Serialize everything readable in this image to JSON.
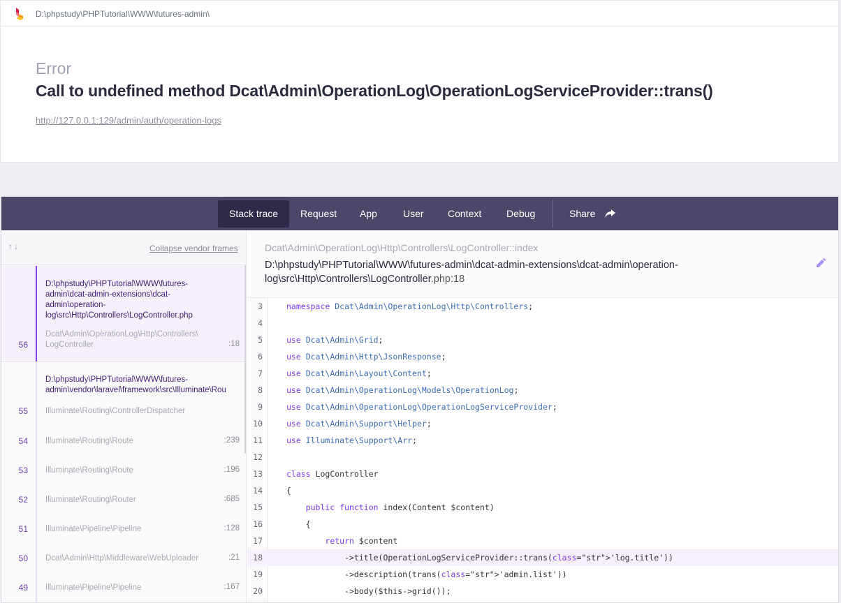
{
  "topbar": {
    "path": "D:\\phpstudy\\PHPTutorial\\WWW\\futures-admin\\"
  },
  "error": {
    "type": "Error",
    "message": "Call to undefined method Dcat\\Admin\\OperationLog\\OperationLogServiceProvider::trans()",
    "url": "http://127.0.0.1:129/admin/auth/operation-logs"
  },
  "tabs": [
    {
      "label": "Stack trace",
      "active": true
    },
    {
      "label": "Request"
    },
    {
      "label": "App"
    },
    {
      "label": "User"
    },
    {
      "label": "Context"
    },
    {
      "label": "Debug"
    },
    {
      "label": "Share"
    }
  ],
  "frames_panel": {
    "sort_arrows": "↑↓",
    "collapse_label": "Collapse vendor frames"
  },
  "frames": [
    {
      "num": "56",
      "file": "D:\\phpstudy\\PHPTutorial\\WWW\\futures-\nadmin\\dcat-admin-extensions\\dcat-\nadmin\\operation-\nlog\\src\\Http\\Controllers\\LogController.php",
      "cls": "Dcat\\Admin\\OperationLog\\Http\\Controllers\\\nLogController",
      "line": ":18",
      "selected": true
    },
    {
      "num": "55",
      "file": "D:\\phpstudy\\PHPTutorial\\WWW\\futures-\nadmin\\vendor\\laravel\\framework\\src\\Illuminate\\Rou",
      "cls": "Illuminate\\Routing\\ControllerDispatcher",
      "line": ""
    },
    {
      "num": "54",
      "cls": "Illuminate\\Routing\\Route",
      "line": ":239"
    },
    {
      "num": "53",
      "cls": "Illuminate\\Routing\\Route",
      "line": ":196"
    },
    {
      "num": "52",
      "cls": "Illuminate\\Routing\\Router",
      "line": ":685"
    },
    {
      "num": "51",
      "cls": "Illuminate\\Pipeline\\Pipeline",
      "line": ":128"
    },
    {
      "num": "50",
      "cls": "Dcat\\Admin\\Http\\Middleware\\WebUploader",
      "line": ":21"
    },
    {
      "num": "49",
      "cls": "Illuminate\\Pipeline\\Pipeline",
      "line": ":167"
    }
  ],
  "code_header": {
    "namespace": "Dcat\\Admin\\OperationLog\\Http\\Controllers\\LogController::index",
    "file": "D:\\phpstudy\\PHPTutorial\\WWW\\futures-admin\\dcat-admin-extensions\\dcat-admin\\operation-log\\src\\Http\\Controllers\\LogController",
    "ext_line": ".php:18"
  },
  "code_lines": [
    {
      "n": "3",
      "t": "namespace Dcat\\Admin\\OperationLog\\Http\\Controllers;"
    },
    {
      "n": "4",
      "t": ""
    },
    {
      "n": "5",
      "t": "use Dcat\\Admin\\Grid;"
    },
    {
      "n": "6",
      "t": "use Dcat\\Admin\\Http\\JsonResponse;"
    },
    {
      "n": "7",
      "t": "use Dcat\\Admin\\Layout\\Content;"
    },
    {
      "n": "8",
      "t": "use Dcat\\Admin\\OperationLog\\Models\\OperationLog;"
    },
    {
      "n": "9",
      "t": "use Dcat\\Admin\\OperationLog\\OperationLogServiceProvider;"
    },
    {
      "n": "10",
      "t": "use Dcat\\Admin\\Support\\Helper;"
    },
    {
      "n": "11",
      "t": "use Illuminate\\Support\\Arr;"
    },
    {
      "n": "12",
      "t": ""
    },
    {
      "n": "13",
      "t": "class LogController"
    },
    {
      "n": "14",
      "t": "{"
    },
    {
      "n": "15",
      "t": "    public function index(Content $content)"
    },
    {
      "n": "16",
      "t": "    {"
    },
    {
      "n": "17",
      "t": "        return $content"
    },
    {
      "n": "18",
      "t": "            ->title(OperationLogServiceProvider::trans('log.title'))",
      "hl": true
    },
    {
      "n": "19",
      "t": "            ->description(trans('admin.list'))"
    },
    {
      "n": "20",
      "t": "            ->body($this->grid());"
    }
  ]
}
